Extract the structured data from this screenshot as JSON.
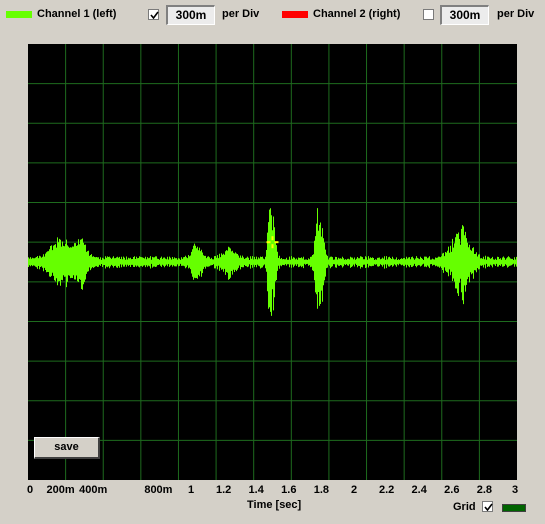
{
  "channel1": {
    "label": "Channel 1 (left)",
    "color": "#66ff00",
    "enabled": true,
    "scale": "300m",
    "per_div": "per Div"
  },
  "channel2": {
    "label": "Channel 2 (right)",
    "color": "#ff0000",
    "enabled": false,
    "scale": "300m",
    "per_div": "per Div"
  },
  "plot": {
    "background": "#000000",
    "grid_color": "#1e6b1e",
    "save_label": "save",
    "grid_label": "Grid",
    "grid_enabled": true,
    "grid_swatch_color": "#006400"
  },
  "chart_data": {
    "type": "line",
    "xlabel": "Time [sec]",
    "ylabel": "",
    "xlim": [
      0,
      3
    ],
    "ylim": [
      -1.65,
      1.65
    ],
    "x_tick_labels": [
      "0",
      "200m",
      "400m",
      "800m",
      "1",
      "1.2",
      "1.4",
      "1.6",
      "1.8",
      "2",
      "2.2",
      "2.4",
      "2.6",
      "2.8",
      "3"
    ],
    "x_tick_values": [
      0,
      0.2,
      0.4,
      0.8,
      1,
      1.2,
      1.4,
      1.6,
      1.8,
      2,
      2.2,
      2.4,
      2.6,
      2.8,
      3
    ],
    "grid": true,
    "series": [
      {
        "color": "#66ff00",
        "noise_amplitude": 0.03,
        "bursts": [
          {
            "t": 0.2,
            "amp": 0.12,
            "width": 0.08
          },
          {
            "t": 0.32,
            "amp": 0.1,
            "width": 0.05
          },
          {
            "t": 1.03,
            "amp": 0.09,
            "width": 0.04
          },
          {
            "t": 1.23,
            "amp": 0.06,
            "width": 0.05
          },
          {
            "t": 1.48,
            "amp": 0.35,
            "width": 0.015
          },
          {
            "t": 1.5,
            "amp": 0.2,
            "width": 0.02
          },
          {
            "t": 1.77,
            "amp": 0.35,
            "width": 0.015
          },
          {
            "t": 1.8,
            "amp": 0.2,
            "width": 0.02
          },
          {
            "t": 2.65,
            "amp": 0.18,
            "width": 0.07
          }
        ],
        "marker": {
          "t": 1.5,
          "y": 0.15
        }
      }
    ]
  }
}
